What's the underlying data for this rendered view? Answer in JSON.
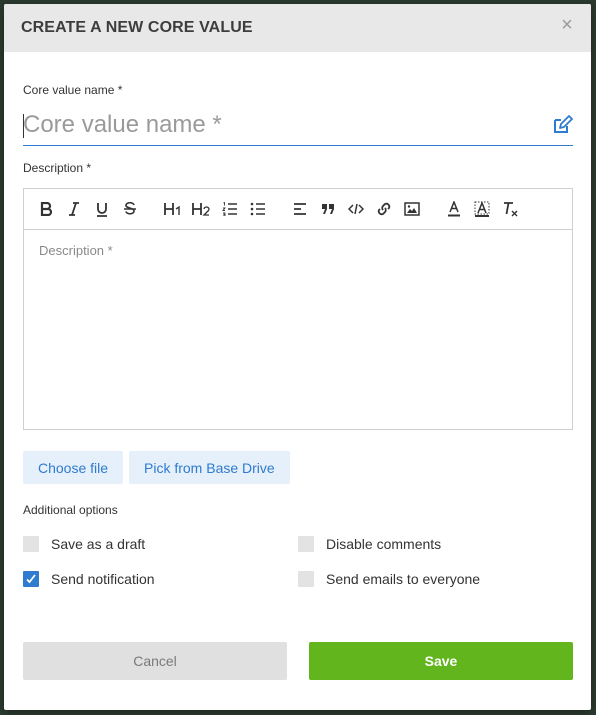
{
  "dialog": {
    "title": "CREATE A NEW CORE VALUE",
    "close_glyph": "×"
  },
  "name_field": {
    "label": "Core value name *",
    "placeholder": "Core value name *",
    "value": "",
    "icon": "edit-icon"
  },
  "description": {
    "label": "Description *",
    "placeholder": "Description *",
    "toolbar": [
      {
        "name": "bold",
        "icon": "bold-icon"
      },
      {
        "name": "italic",
        "icon": "italic-icon"
      },
      {
        "name": "underline",
        "icon": "underline-icon"
      },
      {
        "name": "strikethrough",
        "icon": "strikethrough-icon"
      },
      {
        "name": "heading-1",
        "icon": "h1-icon"
      },
      {
        "name": "heading-2",
        "icon": "h2-icon"
      },
      {
        "name": "ordered-list",
        "icon": "ordered-list-icon"
      },
      {
        "name": "bullet-list",
        "icon": "bullet-list-icon"
      },
      {
        "name": "align",
        "icon": "align-left-icon"
      },
      {
        "name": "blockquote",
        "icon": "quote-icon"
      },
      {
        "name": "code",
        "icon": "code-icon"
      },
      {
        "name": "link",
        "icon": "link-icon"
      },
      {
        "name": "image",
        "icon": "image-icon"
      },
      {
        "name": "text-color",
        "icon": "font-color-icon"
      },
      {
        "name": "background-color",
        "icon": "background-color-icon"
      },
      {
        "name": "clear-formatting",
        "icon": "clear-format-icon"
      }
    ]
  },
  "attachments": {
    "choose_file": "Choose file",
    "pick_drive": "Pick from Base Drive"
  },
  "options": {
    "heading": "Additional options",
    "items": [
      {
        "label": "Save as a draft",
        "checked": false
      },
      {
        "label": "Disable comments",
        "checked": false
      },
      {
        "label": "Send notification",
        "checked": true
      },
      {
        "label": "Send emails to everyone",
        "checked": false
      }
    ]
  },
  "footer": {
    "cancel": "Cancel",
    "save": "Save"
  },
  "colors": {
    "accent": "#2e7bcf",
    "save_green": "#63b51e",
    "header_bg": "#e8e8e8"
  }
}
